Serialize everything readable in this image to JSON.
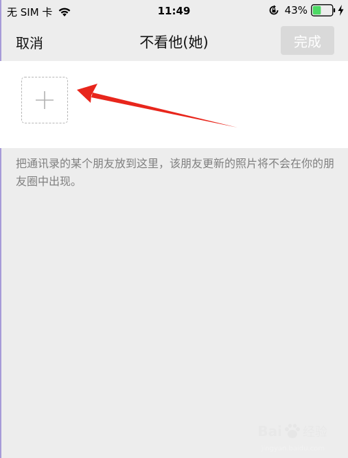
{
  "status_bar": {
    "carrier": "无 SIM 卡",
    "time": "11:49",
    "battery_percent": "43%",
    "battery_level": 0.43,
    "battery_color": "#4cd964",
    "icons": [
      "wifi-icon",
      "rotation-lock-icon",
      "battery-icon",
      "charging-bolt-icon"
    ]
  },
  "nav": {
    "cancel_label": "取消",
    "title": "不看他(她)",
    "done_label": "完成"
  },
  "members": {
    "add_icon": "plus-icon"
  },
  "hint": "把通讯录的某个朋友放到这里，该朋友更新的照片将不会在你的朋友圈中出现。",
  "annotation": {
    "arrow_color": "#e8261c"
  },
  "watermark": {
    "brand": "Bai",
    "brand_suffix": "经验",
    "url": "jingyan.baidu.com"
  },
  "colors": {
    "background": "#ededed",
    "panel": "#ffffff",
    "done_button_bg": "#d9d9d9",
    "hint_text": "#7f7f7f"
  }
}
